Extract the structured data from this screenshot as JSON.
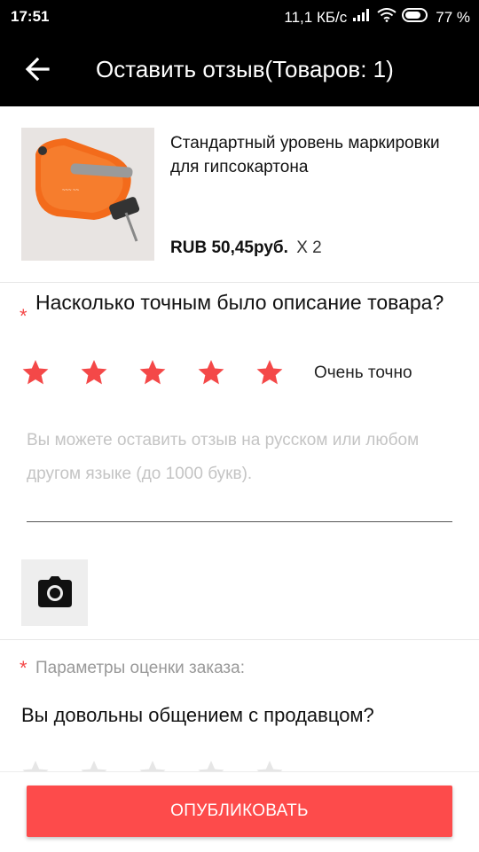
{
  "status_bar": {
    "time": "17:51",
    "network_speed": "11,1 КБ/с",
    "battery": "77 %",
    "icons": [
      "signal-icon",
      "wifi-icon",
      "battery-icon"
    ]
  },
  "header": {
    "title": "Оставить отзыв(Товаров: 1)",
    "back_icon": "arrow-left-icon"
  },
  "product": {
    "name": "Стандартный уровень маркировки для гипсокартона",
    "price": "RUB 50,45руб.",
    "quantity": "X 2"
  },
  "accuracy": {
    "required_mark": "*",
    "question": "Насколько точным было описание товара?",
    "rating": 5,
    "max_rating": 5,
    "rating_label": "Очень точно"
  },
  "review": {
    "placeholder": "Вы можете оставить отзыв на русском или любом другом языке (до 1000 букв).",
    "value": ""
  },
  "photo": {
    "icon": "camera-icon"
  },
  "order_params": {
    "required_mark": "*",
    "title": "Параметры оценки заказа:",
    "seller_question": "Вы довольны общением с продавцом?",
    "rating": 0,
    "max_rating": 5
  },
  "footer": {
    "publish_label": "ОПУБЛИКОВАТЬ"
  },
  "colors": {
    "accent": "#fd4b4b",
    "star_active": "#f44848",
    "star_inactive": "#e6e6e6",
    "header_bg": "#000000"
  }
}
